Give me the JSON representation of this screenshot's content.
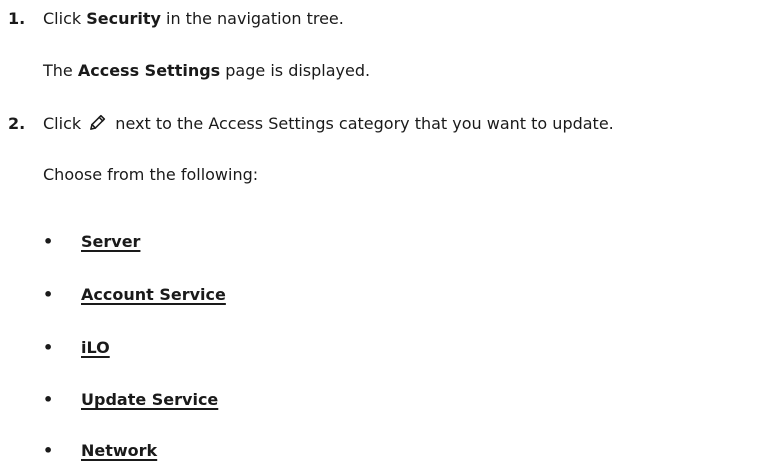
{
  "steps": [
    {
      "number": "1.",
      "click_prefix": "Click ",
      "target_bold": "Security",
      "suffix": " in the navigation tree.",
      "result_prefix": "The ",
      "result_bold": "Access Settings",
      "result_suffix": " page is displayed."
    },
    {
      "number": "2.",
      "click_prefix": "Click ",
      "icon": "pencil-edit-icon",
      "suffix": " next to the Access Settings category that you want to update.",
      "choose_text": "Choose from the following:"
    }
  ],
  "bullet_char": "•",
  "categories": [
    "Server",
    "Account Service",
    "iLO",
    "Update Service",
    "Network"
  ]
}
